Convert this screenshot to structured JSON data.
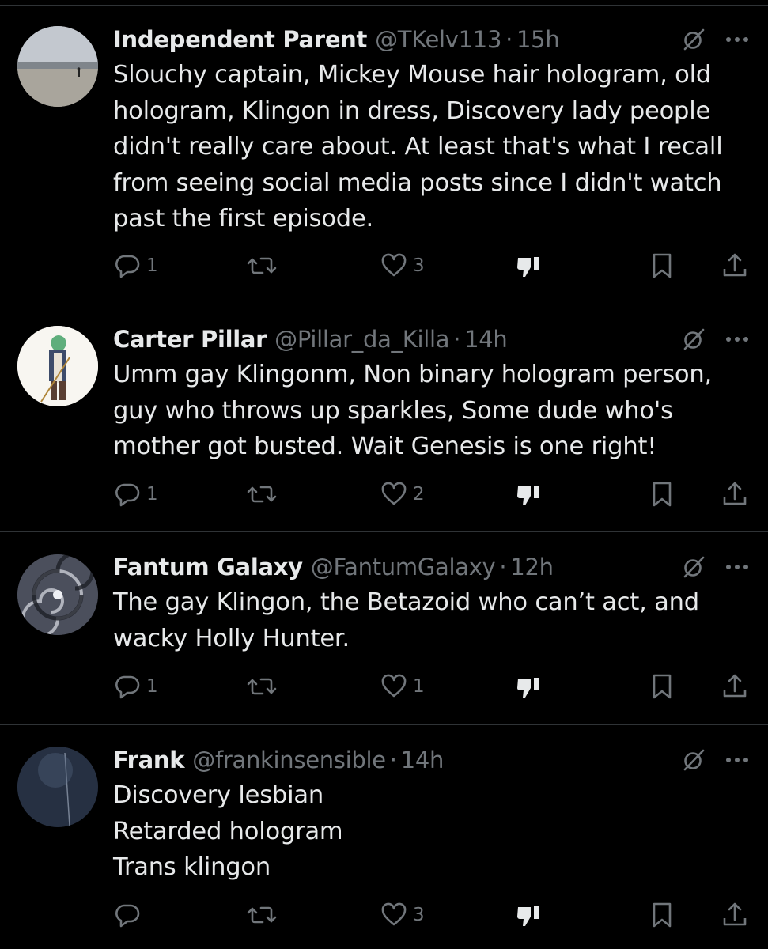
{
  "colors": {
    "background": "#000000",
    "text": "#e7e9ea",
    "secondary": "#71767b",
    "divider": "#2f3336"
  },
  "icons": {
    "reply": "reply-icon",
    "repost": "repost-icon",
    "like": "like-icon",
    "dislike": "dislike-icon",
    "bookmark": "bookmark-icon",
    "share": "share-icon",
    "grok": "grok-icon",
    "more": "more-icon"
  },
  "tweets": [
    {
      "name": "Independent Parent",
      "handle": "@TKelv113",
      "dot": "·",
      "time": "15h",
      "lines": [
        "Slouchy captain, Mickey Mouse hair hologram, old",
        "hologram, Klingon in dress, Discovery lady people",
        "didn't really care about. At least that's what I recall",
        "from seeing social media posts since I didn't watch",
        "past the first episode."
      ],
      "replies": "1",
      "reposts": "",
      "likes": "3"
    },
    {
      "name": "Carter Pillar",
      "handle": "@Pillar_da_Killa",
      "dot": "·",
      "time": "14h",
      "lines": [
        "Umm gay Klingonm, Non binary hologram person,",
        "guy who throws up sparkles, Some dude who's",
        "mother got busted. Wait Genesis is one right!"
      ],
      "replies": "1",
      "reposts": "",
      "likes": "2"
    },
    {
      "name": "Fantum Galaxy",
      "handle": "@FantumGalaxy",
      "dot": "·",
      "time": "12h",
      "lines": [
        "The gay Klingon, the Betazoid who can’t act, and",
        "wacky Holly Hunter."
      ],
      "replies": "1",
      "reposts": "",
      "likes": "1"
    },
    {
      "name": "Frank",
      "handle": "@frankinsensible",
      "dot": "·",
      "time": "14h",
      "lines": [
        "Discovery lesbian",
        "Retarded hologram",
        "Trans klingon"
      ],
      "replies": "",
      "reposts": "",
      "likes": "3"
    }
  ]
}
